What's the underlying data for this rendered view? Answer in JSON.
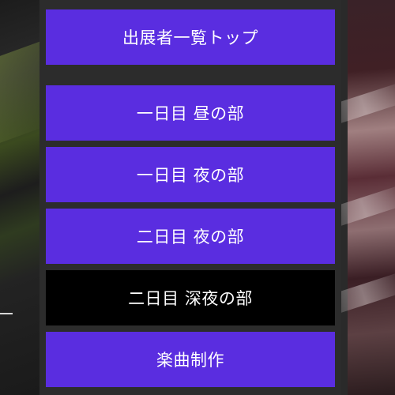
{
  "menu": {
    "items": [
      {
        "label": "出展者一覧トップ",
        "state": "normal"
      },
      {
        "label": "一日目 昼の部",
        "state": "normal"
      },
      {
        "label": "一日目 夜の部",
        "state": "normal"
      },
      {
        "label": "二日目 夜の部",
        "state": "normal"
      },
      {
        "label": "二日目 深夜の部",
        "state": "selected"
      },
      {
        "label": "楽曲制作",
        "state": "normal"
      }
    ]
  },
  "colors": {
    "button_purple": "#5a2de0",
    "button_selected": "#000000",
    "menu_background": "#2c2c2c",
    "text": "#ffffff"
  }
}
